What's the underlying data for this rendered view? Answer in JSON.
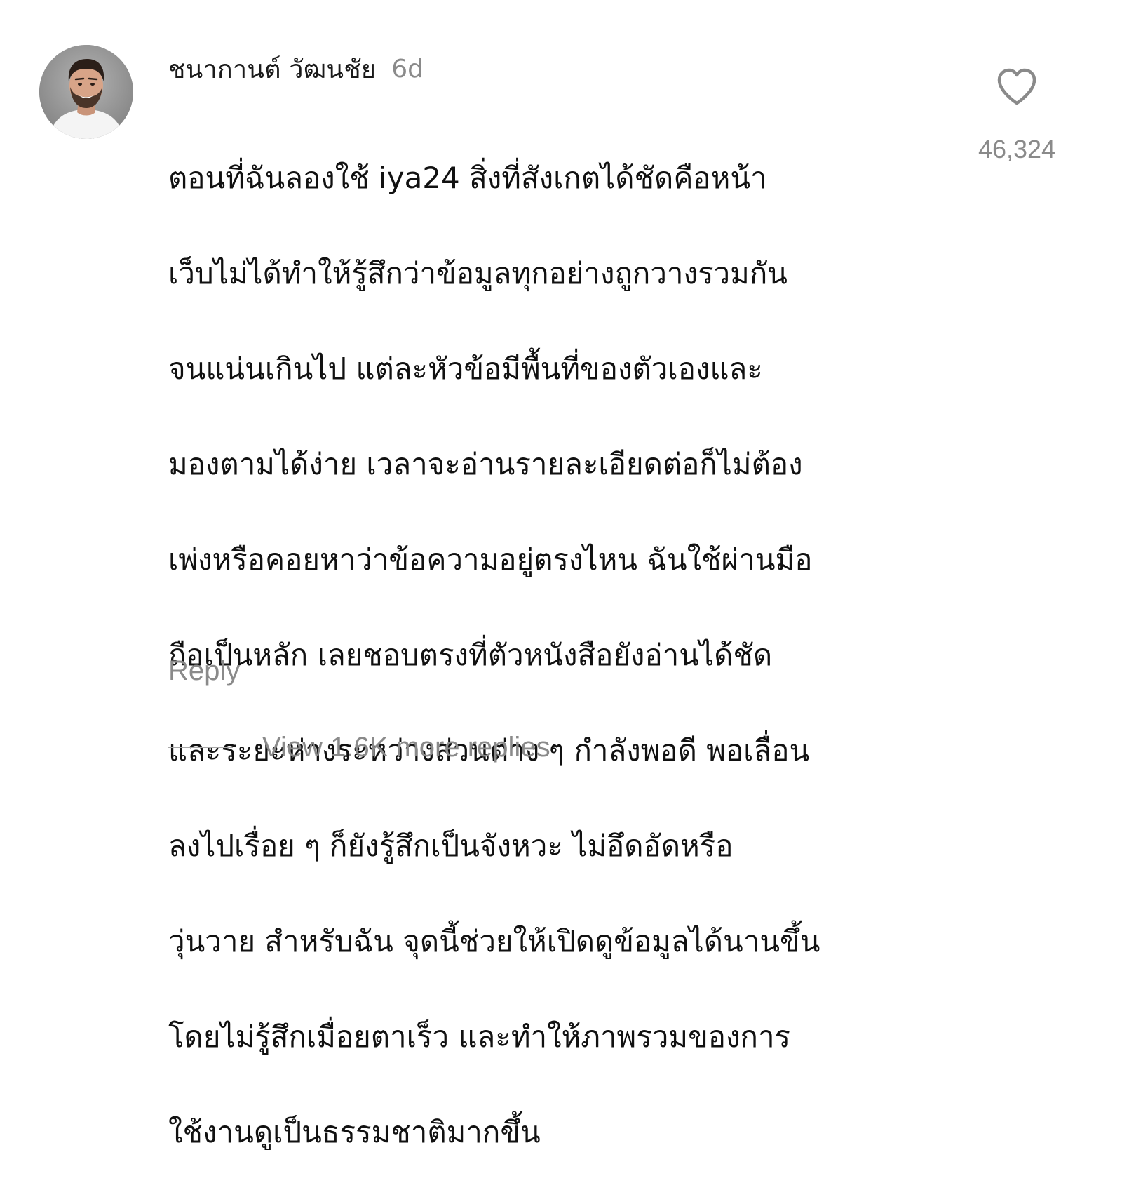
{
  "comment": {
    "avatar_icon": "user-avatar-photo",
    "username": "ชนากานต์ วัฒนชัย",
    "timestamp": "6d",
    "body_lines": [
      "ตอนที่ฉันลองใช้ iya24 สิ่งที่สังเกตได้ชัดคือหน้า",
      "เว็บไม่ได้ทำให้รู้สึกว่าข้อมูลทุกอย่างถูกวางรวมกัน",
      "จนแน่นเกินไป แต่ละหัวข้อมีพื้นที่ของตัวเองและ",
      "มองตามได้ง่าย เวลาจะอ่านรายละเอียดต่อก็ไม่ต้อง",
      "เพ่งหรือคอยหาว่าข้อความอยู่ตรงไหน ฉันใช้ผ่านมือ",
      "ถือเป็นหลัก เลยชอบตรงที่ตัวหนังสือยังอ่านได้ชัด",
      "และระยะห่างระหว่างส่วนต่าง ๆ กำลังพอดี พอเลื่อน",
      "ลงไปเรื่อย ๆ ก็ยังรู้สึกเป็นจังหวะ ไม่อึดอัดหรือ",
      "วุ่นวาย สำหรับฉัน จุดนี้ช่วยให้เปิดดูข้อมูลได้นานขึ้น",
      "โดยไม่รู้สึกเมื่อยตาเร็ว และทำให้ภาพรวมของการ",
      "ใช้งานดูเป็นธรรมชาติมากขึ้น"
    ],
    "like_icon": "heart-outline-icon",
    "like_count": "46,324",
    "reply_label": "Reply",
    "view_replies_label": "View 1.6K more replies"
  },
  "colors": {
    "primary_text": "#111111",
    "secondary_text": "#8a8a8a",
    "background": "#ffffff"
  }
}
